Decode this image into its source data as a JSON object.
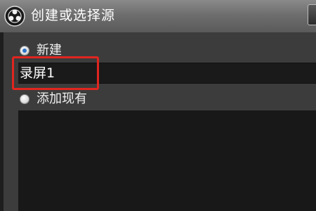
{
  "window": {
    "title": "创建或选择源",
    "icon": "obs-logo-icon"
  },
  "options": {
    "new_label": "新建",
    "new_selected": true,
    "name_value": "录屏1",
    "existing_label": "添加现有",
    "existing_selected": false
  },
  "colors": {
    "highlight": "#e0251f",
    "radio_dot": "#2d73c8"
  }
}
